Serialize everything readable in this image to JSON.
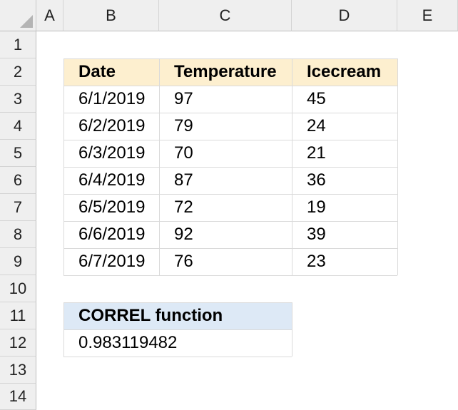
{
  "columns": [
    "A",
    "B",
    "C",
    "D",
    "E"
  ],
  "rows": [
    "1",
    "2",
    "3",
    "4",
    "5",
    "6",
    "7",
    "8",
    "9",
    "10",
    "11",
    "12",
    "13",
    "14"
  ],
  "table": {
    "headers": [
      "Date",
      "Temperature",
      "Icecream"
    ],
    "rows": [
      [
        "6/1/2019",
        "97",
        "45"
      ],
      [
        "6/2/2019",
        "79",
        "24"
      ],
      [
        "6/3/2019",
        "70",
        "21"
      ],
      [
        "6/4/2019",
        "87",
        "36"
      ],
      [
        "6/5/2019",
        "72",
        "19"
      ],
      [
        "6/6/2019",
        "92",
        "39"
      ],
      [
        "6/7/2019",
        "76",
        "23"
      ]
    ]
  },
  "correl": {
    "label": "CORREL function",
    "value": "0.983119482"
  },
  "colors": {
    "table_header_fill": "#fdefcf",
    "function_header_fill": "#dde9f6",
    "header_bg": "#efefef"
  }
}
